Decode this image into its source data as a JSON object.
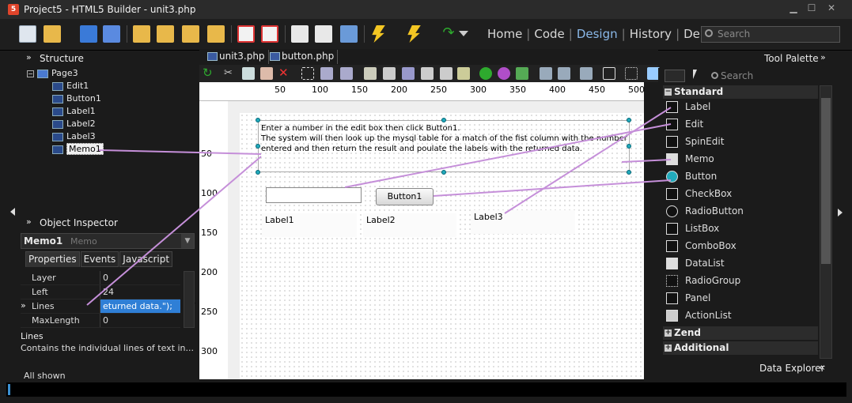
{
  "app": {
    "title": "Project5 - HTML5 Builder - unit3.php",
    "icon_label": "5"
  },
  "window_controls": {
    "minimize": "▁",
    "maximize": "☐",
    "close": "✕"
  },
  "view_tabs": [
    "Home",
    "Code",
    "Design",
    "History",
    "Debug"
  ],
  "view_tabs_active": "Design",
  "toolbar_search": {
    "placeholder": "Search"
  },
  "structure": {
    "title": "Structure",
    "root": "Page3",
    "children": [
      "Edit1",
      "Button1",
      "Label1",
      "Label2",
      "Label3",
      "Memo1"
    ],
    "selected": "Memo1"
  },
  "object_inspector": {
    "title": "Object Inspector",
    "selected_name": "Memo1",
    "selected_class": "Memo",
    "tabs": [
      "Properties",
      "Events",
      "Javascript"
    ],
    "properties": [
      {
        "name": "Layer",
        "value": "0"
      },
      {
        "name": "Left",
        "value": "24"
      },
      {
        "name": "Lines",
        "value": "eturned data.\");"
      },
      {
        "name": "MaxLength",
        "value": "0"
      }
    ],
    "help_title": "Lines",
    "help_text": "Contains the individual lines of text in...",
    "footer": "All shown"
  },
  "designer": {
    "file_tabs": [
      "unit3.php",
      "button.php"
    ],
    "ruler_top": [
      "50",
      "100",
      "150",
      "200",
      "250",
      "300",
      "350",
      "400",
      "450",
      "500"
    ],
    "ruler_left": [
      "50",
      "100",
      "150",
      "200",
      "250",
      "300"
    ],
    "memo_text": "Enter a number in the edit box then click Button1.\nThe system will then look up the mysql table for a match of the fist column with the number\nentered and then return the result and poulate the labels with the returned data.",
    "button_caption": "Button1",
    "labels": [
      "Label1",
      "Label2",
      "Label3"
    ]
  },
  "tool_palette": {
    "title": "Tool Palette",
    "search_placeholder": "Search",
    "categories": [
      {
        "name": "Standard",
        "expand": "−"
      },
      {
        "name": "Zend",
        "expand": "+"
      },
      {
        "name": "Additional",
        "expand": "+"
      }
    ],
    "items": [
      "Label",
      "Edit",
      "SpinEdit",
      "Memo",
      "Button",
      "CheckBox",
      "RadioButton",
      "ListBox",
      "ComboBox",
      "DataList",
      "RadioGroup",
      "Panel",
      "ActionList"
    ]
  },
  "data_explorer": {
    "title": "Data Explorer"
  },
  "colors": {
    "accent": "#8ab8e8",
    "annotation": "#c58fd9",
    "selection": "#2f7fd6"
  }
}
